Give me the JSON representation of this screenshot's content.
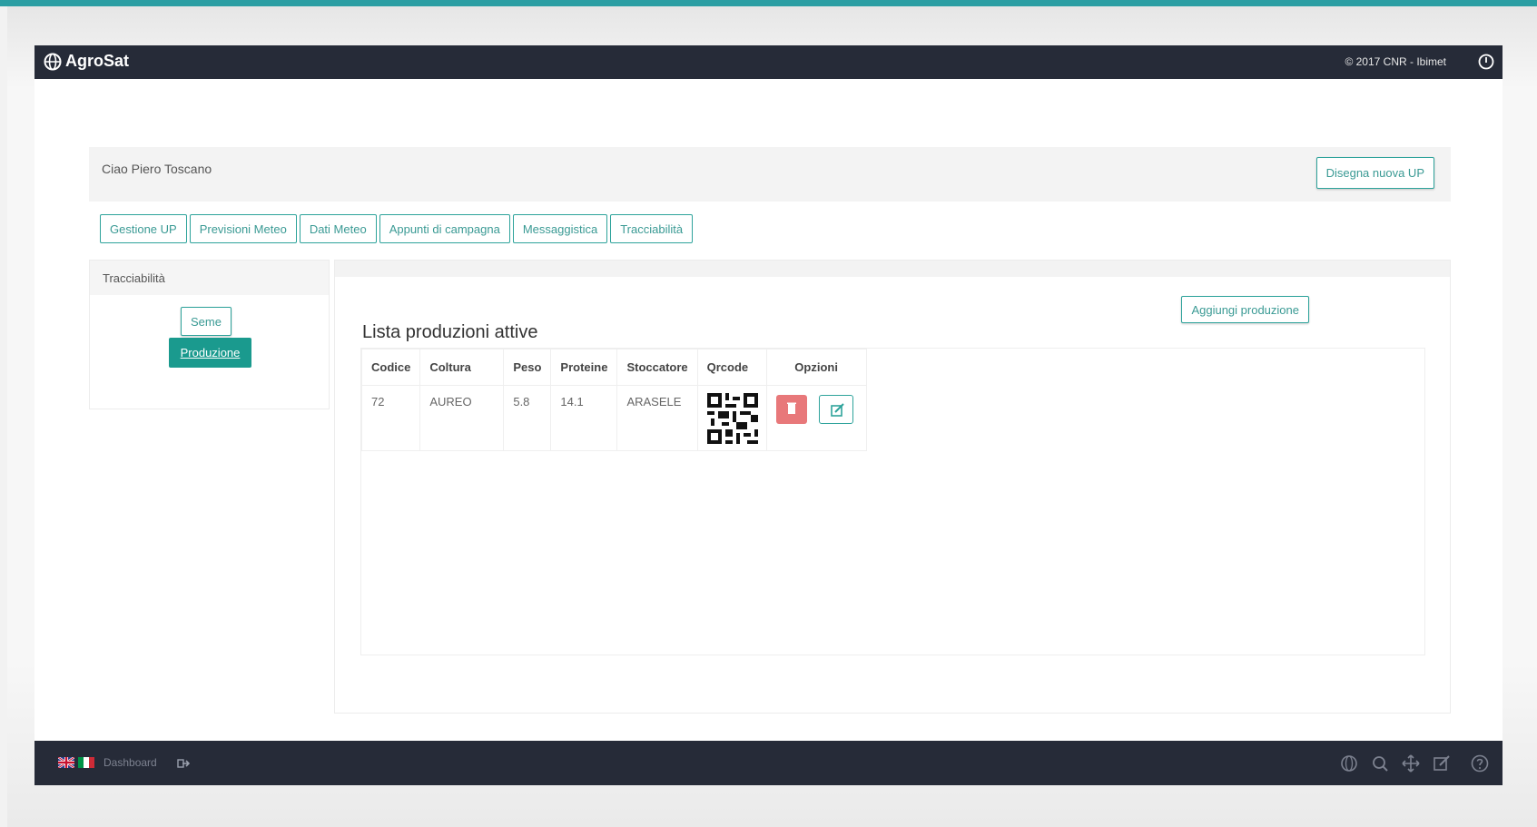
{
  "app": {
    "brand": "AgroSat",
    "copyright": "© 2017 CNR - Ibimet"
  },
  "header": {
    "greeting": "Ciao Piero Toscano",
    "draw_button": "Disegna nuova UP"
  },
  "tabs": [
    {
      "label": "Gestione UP"
    },
    {
      "label": "Previsioni Meteo"
    },
    {
      "label": "Dati Meteo"
    },
    {
      "label": "Appunti di campagna"
    },
    {
      "label": "Messaggistica"
    },
    {
      "label": "Tracciabilità"
    }
  ],
  "left_panel": {
    "title": "Tracciabilità",
    "seme_button": "Seme",
    "produzione_button": "Produzione"
  },
  "main": {
    "add_button": "Aggiungi produzione",
    "list_title": "Lista produzioni attive",
    "table": {
      "headers": [
        "Codice",
        "Coltura",
        "Peso",
        "Proteine",
        "Stoccatore",
        "Qrcode",
        "Opzioni"
      ],
      "rows": [
        {
          "codice": "72",
          "coltura": "AUREO",
          "peso": "5.8",
          "proteine": "14.1",
          "stoccatore": "ARASELE"
        }
      ]
    }
  },
  "footer": {
    "dashboard_link": "Dashboard",
    "icons": [
      "globe-icon",
      "search-icon",
      "move-icon",
      "edit-icon",
      "help-icon"
    ]
  },
  "colors": {
    "topbar": "#262b38",
    "accent": "#1a9a8e",
    "danger": "#e8787a",
    "teal_line": "#2b9ea3"
  }
}
